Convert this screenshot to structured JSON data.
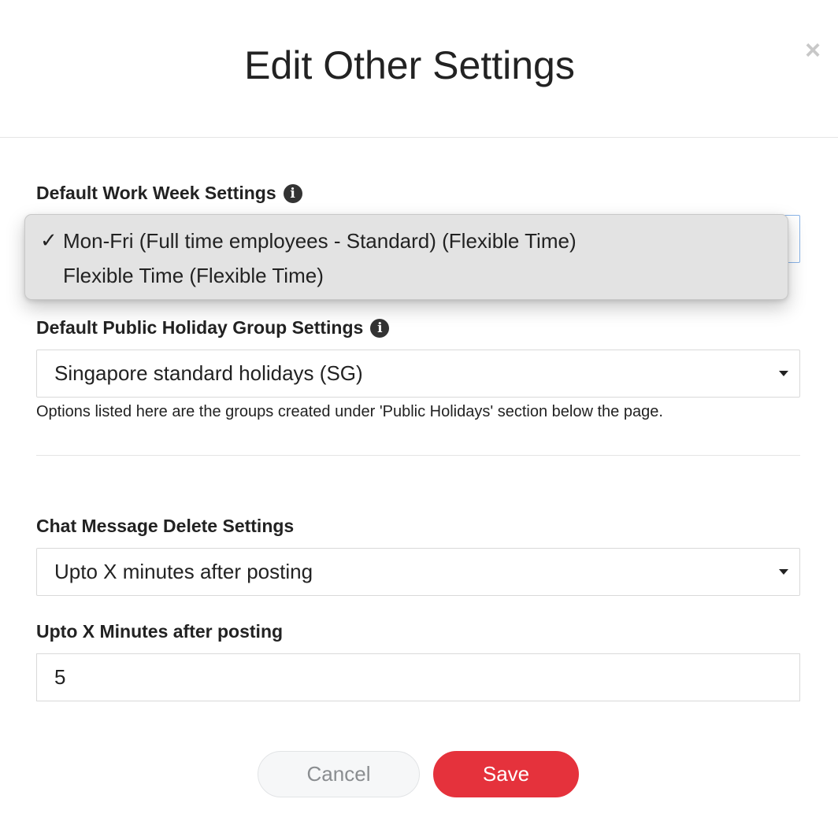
{
  "modal": {
    "title": "Edit Other Settings",
    "close_icon": "close-icon"
  },
  "work_week": {
    "label": "Default Work Week Settings",
    "info_icon": "i",
    "options": [
      {
        "label": "Mon-Fri (Full time employees - Standard) (Flexible Time)",
        "selected": true,
        "check": "✓"
      },
      {
        "label": "Flexible Time (Flexible Time)",
        "selected": false,
        "check": ""
      }
    ]
  },
  "public_holiday": {
    "label": "Default Public Holiday Group Settings",
    "info_icon": "i",
    "value": "Singapore standard holidays (SG)",
    "helper": "Options listed here are the groups created under 'Public Holidays' section below the page."
  },
  "chat_delete": {
    "label": "Chat Message Delete Settings",
    "value": "Upto X minutes after posting"
  },
  "minutes": {
    "label": "Upto X Minutes after posting",
    "value": "5"
  },
  "buttons": {
    "cancel": "Cancel",
    "save": "Save"
  },
  "colors": {
    "save_bg": "#e5323c",
    "cancel_bg": "#f6f7f8",
    "dropdown_bg": "#e3e3e3",
    "focus_border": "#8ab4e8"
  }
}
